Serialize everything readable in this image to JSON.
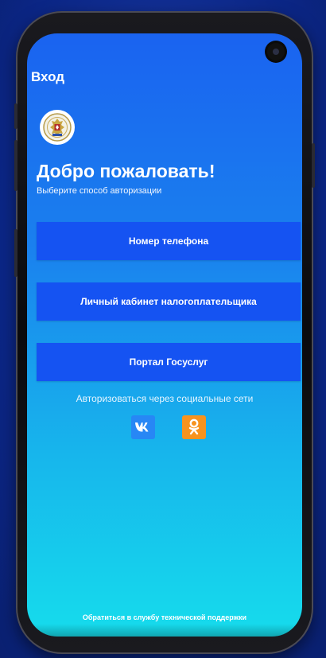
{
  "header": {
    "title": "Вход"
  },
  "emblem": {
    "icon": "fns-emblem-icon"
  },
  "welcome": {
    "title": "Добро пожаловать!",
    "subtitle": "Выберите способ авторизации"
  },
  "auth_options": [
    {
      "label": "Номер телефона"
    },
    {
      "label": "Личный кабинет налогоплательщика"
    },
    {
      "label": "Портал Госуслуг"
    }
  ],
  "social": {
    "caption": "Авторизоваться через социальные сети",
    "items": [
      {
        "name": "vk",
        "icon": "vk-icon",
        "color": "#2787f5"
      },
      {
        "name": "odnoklassniki",
        "icon": "odnoklassniki-icon",
        "color": "#f7931e"
      }
    ]
  },
  "support": {
    "label": "Обратиться в службу технической поддержки"
  },
  "colors": {
    "button": "#1553f2",
    "screen_top": "#1a63f0",
    "screen_bottom": "#16dcec",
    "background": "#0d2a8c"
  }
}
